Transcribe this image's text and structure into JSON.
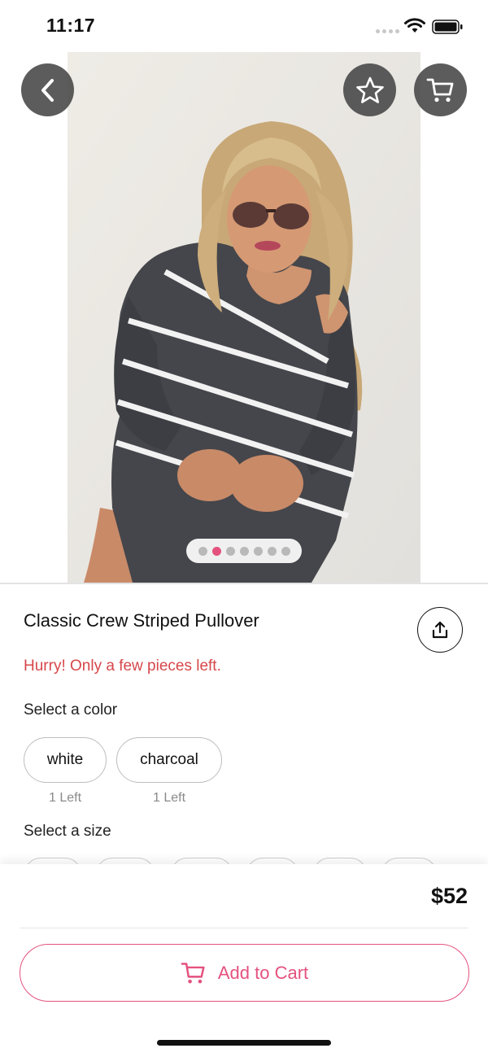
{
  "status_bar": {
    "time": "11:17"
  },
  "product": {
    "title": "Classic Crew Striped Pullover",
    "urgency": "Hurry! Only a few pieces left.",
    "image_count": 7,
    "active_image": 2,
    "price": "$52"
  },
  "colors": {
    "label": "Select a color",
    "options": [
      {
        "name": "white",
        "stock": "1 Left"
      },
      {
        "name": "charcoal",
        "stock": "1 Left"
      }
    ]
  },
  "sizes": {
    "label": "Select a size"
  },
  "actions": {
    "add_to_cart": "Add to Cart"
  },
  "theme": {
    "accent": "#e4527e",
    "urgency": "#d6474b",
    "overlay_button": "#464646"
  },
  "icons": [
    "back-icon",
    "star-icon",
    "cart-icon",
    "share-icon",
    "cart-icon"
  ]
}
